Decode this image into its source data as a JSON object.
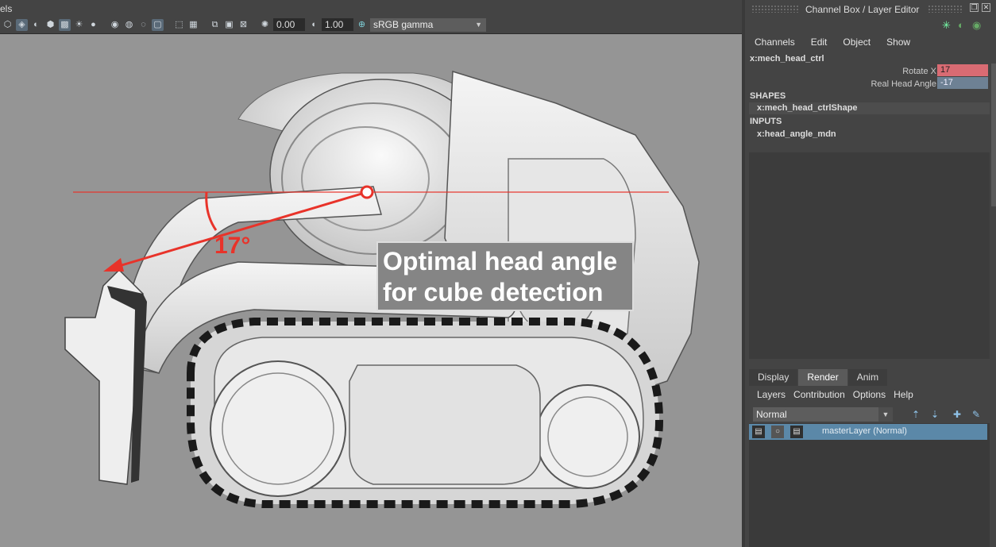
{
  "viewport": {
    "menu_fragment": "els",
    "exposure_value": "0.00",
    "gamma_value": "1.00",
    "color_space": "sRGB gamma",
    "annotation_text_line1": "Optimal head angle",
    "annotation_text_line2": "for cube detection",
    "angle_label": "17°",
    "accent_color": "#e8332a"
  },
  "channel_box": {
    "title": "Channel Box / Layer Editor",
    "menu": [
      "Channels",
      "Edit",
      "Object",
      "Show"
    ],
    "node": "x:mech_head_ctrl",
    "attributes": [
      {
        "label": "Rotate X",
        "value": "17",
        "color": "#d96b73"
      },
      {
        "label": "Real Head Angle",
        "value": "-17",
        "color": "#6e8194"
      }
    ],
    "shapes_header": "SHAPES",
    "shape": "x:mech_head_ctrlShape",
    "inputs_header": "INPUTS",
    "input": "x:head_angle_mdn"
  },
  "layer_editor": {
    "tabs": [
      "Display",
      "Render",
      "Anim"
    ],
    "active_tab": "Render",
    "menu": [
      "Layers",
      "Contribution",
      "Options",
      "Help"
    ],
    "blend_mode": "Normal",
    "layer_name": "masterLayer (Normal)"
  }
}
